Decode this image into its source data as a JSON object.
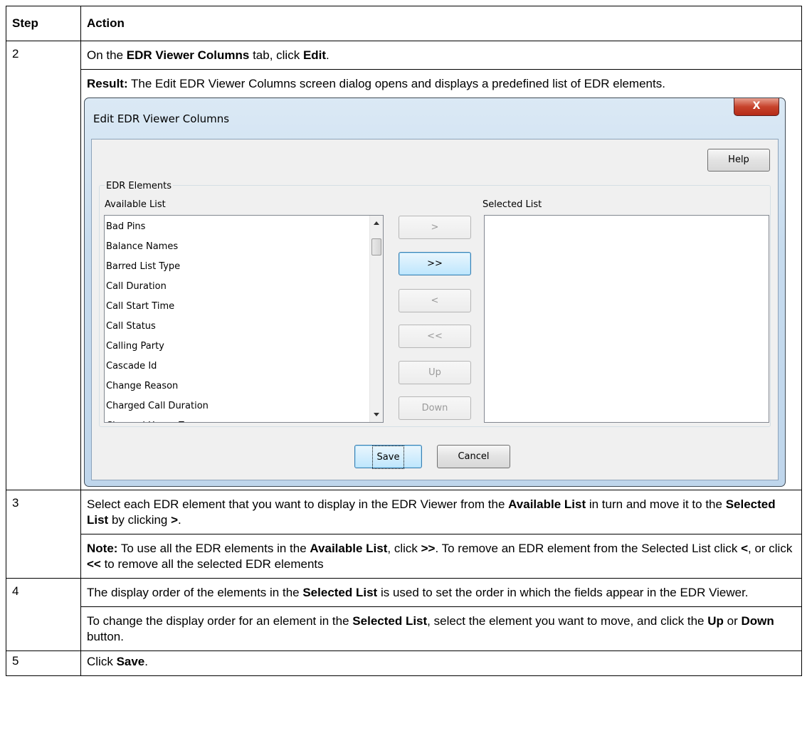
{
  "table": {
    "headers": {
      "step": "Step",
      "action": "Action"
    },
    "rows": {
      "r2": {
        "step": "2",
        "p1": {
          "a": "On the ",
          "b": "EDR Viewer Columns",
          "c": " tab, click ",
          "d": "Edit",
          "e": "."
        },
        "p2": {
          "a": "Result:",
          "b": " The Edit EDR Viewer Columns screen dialog opens and displays a predefined list of EDR elements."
        }
      },
      "r3": {
        "step": "3",
        "p1": {
          "a": "Select each EDR element that you want to display in the EDR Viewer from the ",
          "b": "Available List",
          "c": " in turn and move it to the ",
          "d": "Selected List",
          "e": " by clicking ",
          "f": ">",
          "g": "."
        },
        "p2": {
          "a": "Note:",
          "b": " To use all the EDR elements in the ",
          "c": "Available List",
          "d": ", click ",
          "e": ">>",
          "f": ". To remove an EDR element from the Selected List click ",
          "g": "<",
          "h": ", or click ",
          "i": "<<",
          "j": " to remove all the selected EDR elements"
        }
      },
      "r4": {
        "step": "4",
        "p1": {
          "a": "The display order of the elements in the ",
          "b": "Selected List",
          "c": " is used to set the order in which the fields appear in the EDR Viewer."
        },
        "p2": {
          "a": "To change the display order for an element in the ",
          "b": "Selected List",
          "c": ", select the element you want to move, and click the ",
          "d": "Up",
          "e": " or ",
          "f": "Down",
          "g": " button."
        }
      },
      "r5": {
        "step": "5",
        "p1": {
          "a": "Click ",
          "b": "Save",
          "c": "."
        }
      }
    }
  },
  "dialog": {
    "title": "Edit EDR Viewer Columns",
    "close_label": "X",
    "help_label": "Help",
    "group_label": "EDR Elements",
    "available_label": "Available List",
    "selected_label": "Selected List",
    "available_items": [
      "Bad Pins",
      "Balance Names",
      "Barred List Type",
      "Call Duration",
      "Call Start Time",
      "Call Status",
      "Calling Party",
      "Cascade Id",
      "Change Reason",
      "Charged Call Duration",
      "Charged Home Zone"
    ],
    "buttons": {
      "add": ">",
      "add_all": ">>",
      "remove": "<",
      "remove_all": "<<",
      "up": "Up",
      "down": "Down",
      "save": "Save",
      "cancel": "Cancel"
    }
  }
}
